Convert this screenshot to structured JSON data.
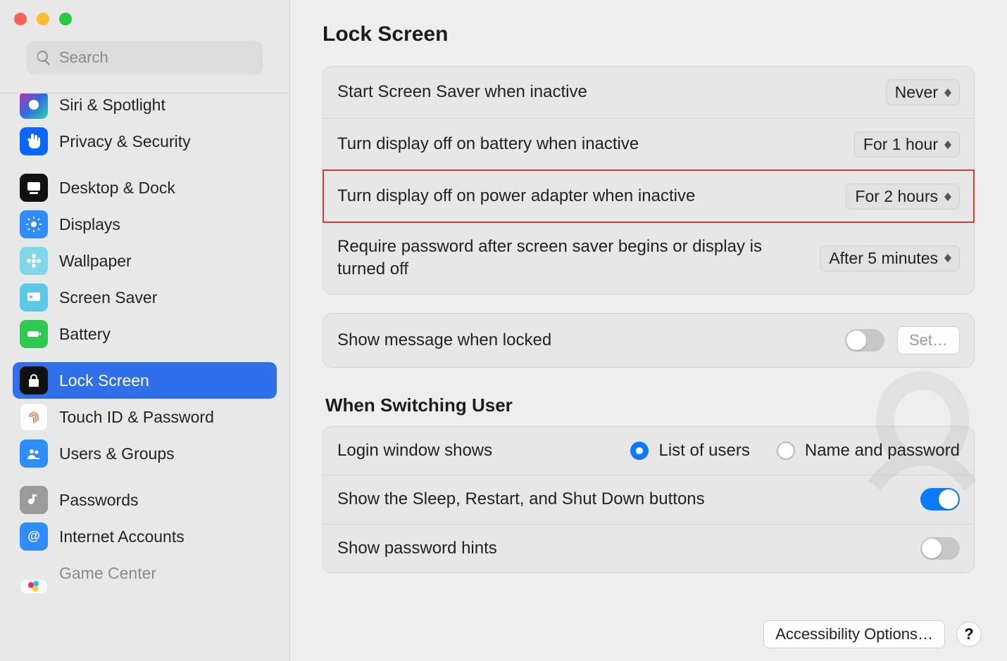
{
  "search": {
    "placeholder": "Search"
  },
  "sidebar": {
    "items": [
      {
        "label": "Siri & Spotlight",
        "bg": "#1a1a1a",
        "icon": "siri"
      },
      {
        "label": "Privacy & Security",
        "bg": "#0a66ff",
        "icon": "hand"
      },
      {
        "label": "Desktop & Dock",
        "bg": "#111111",
        "icon": "dock"
      },
      {
        "label": "Displays",
        "bg": "#2f8cff",
        "icon": "sun"
      },
      {
        "label": "Wallpaper",
        "bg": "#7ed6e8",
        "icon": "flower"
      },
      {
        "label": "Screen Saver",
        "bg": "#5ac8e6",
        "icon": "screensaver"
      },
      {
        "label": "Battery",
        "bg": "#2fc94f",
        "icon": "battery"
      },
      {
        "label": "Lock Screen",
        "bg": "#111111",
        "icon": "lock"
      },
      {
        "label": "Touch ID & Password",
        "bg": "#ffffff",
        "icon": "fingerprint"
      },
      {
        "label": "Users & Groups",
        "bg": "#2f8cff",
        "icon": "users"
      },
      {
        "label": "Passwords",
        "bg": "#9b9b9b",
        "icon": "key"
      },
      {
        "label": "Internet Accounts",
        "bg": "#2f8cff",
        "icon": "at"
      },
      {
        "label": "Game Center",
        "bg": "#ffffff",
        "icon": "gamecenter"
      }
    ],
    "selected_index": 7
  },
  "page": {
    "title": "Lock Screen",
    "rows": [
      {
        "label": "Start Screen Saver when inactive",
        "value": "Never"
      },
      {
        "label": "Turn display off on battery when inactive",
        "value": "For 1 hour"
      },
      {
        "label": "Turn display off on power adapter when inactive",
        "value": "For 2 hours",
        "highlighted": true
      },
      {
        "label": "Require password after screen saver begins or display is turned off",
        "value": "After 5 minutes"
      }
    ],
    "message_row": {
      "label": "Show message when locked",
      "toggle_on": false,
      "button": "Set…"
    },
    "switching": {
      "title": "When Switching User",
      "login_window": {
        "label": "Login window shows",
        "options": [
          "List of users",
          "Name and password"
        ],
        "selected": 0
      },
      "sleep_row": {
        "label": "Show the Sleep, Restart, and Shut Down buttons",
        "on": true
      },
      "hints_row": {
        "label": "Show password hints",
        "on": false
      }
    },
    "footer": {
      "accessibility": "Accessibility Options…",
      "help": "?"
    }
  }
}
